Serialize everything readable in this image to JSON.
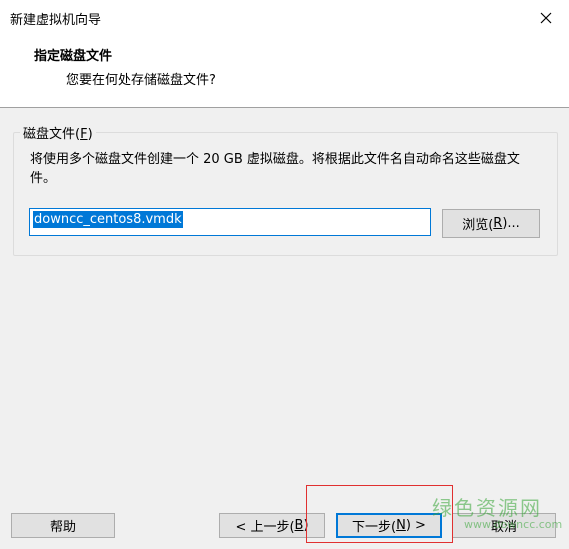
{
  "window": {
    "title": "新建虚拟机向导"
  },
  "header": {
    "title": "指定磁盘文件",
    "subtitle": "您要在何处存储磁盘文件?"
  },
  "group": {
    "label_prefix": "磁盘文件(",
    "label_key": "F",
    "label_suffix": ")",
    "description": "将使用多个磁盘文件创建一个 20 GB 虚拟磁盘。将根据此文件名自动命名这些磁盘文件。"
  },
  "file": {
    "value": "downcc_centos8.vmdk"
  },
  "buttons": {
    "browse_prefix": "浏览(",
    "browse_key": "R",
    "browse_suffix": ")...",
    "help": "帮助",
    "back_prefix": "< 上一步(",
    "back_key": "B",
    "back_suffix": ")",
    "next_prefix": "下一步(",
    "next_key": "N",
    "next_suffix": ") >",
    "cancel": "取消"
  },
  "watermark": {
    "cn": "绿色资源网",
    "en": "www.downcc.com"
  },
  "colors": {
    "accent": "#0078d7",
    "highlight_box": "#e03030",
    "watermark": "#38a638"
  }
}
